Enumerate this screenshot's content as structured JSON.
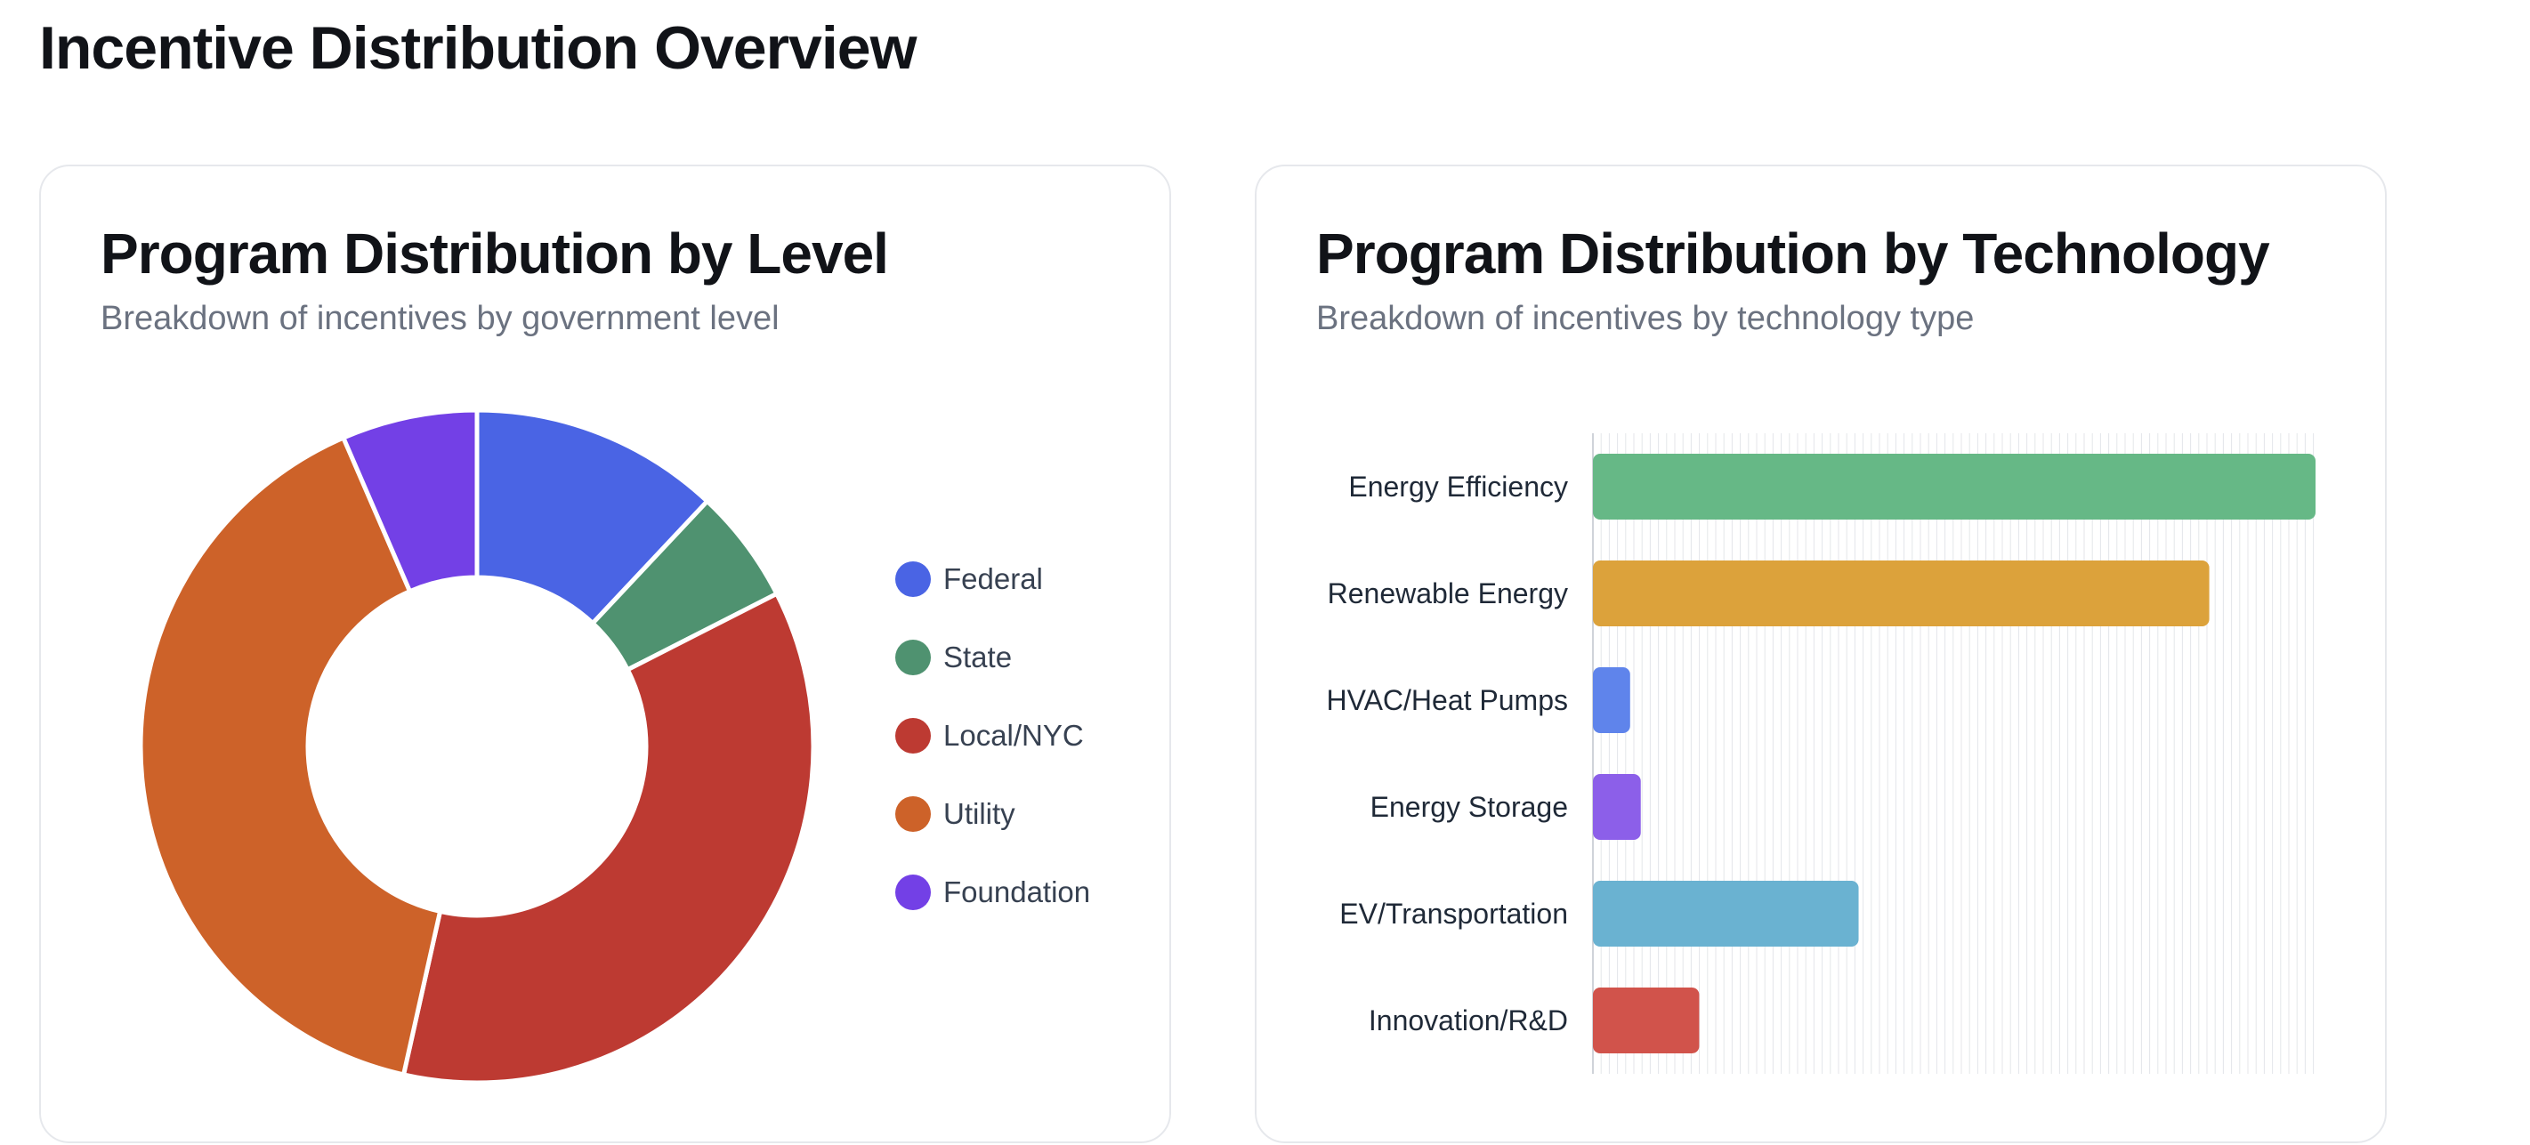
{
  "page": {
    "title": "Incentive Distribution Overview"
  },
  "cards": [
    {
      "title": "Program Distribution by Level",
      "subtitle": "Breakdown of incentives by government level"
    },
    {
      "title": "Program Distribution by Technology",
      "subtitle": "Breakdown of incentives by technology type"
    }
  ],
  "chart_data": [
    {
      "type": "pie",
      "variant": "doughnut",
      "categories": [
        "Federal",
        "State",
        "Local/NYC",
        "Utility",
        "Foundation"
      ],
      "values": [
        12,
        5.5,
        36,
        40,
        6.5
      ],
      "colors": [
        "#4a64e4",
        "#4f9270",
        "#bd3a32",
        "#cd6229",
        "#7340e6"
      ],
      "legend_position": "right"
    },
    {
      "type": "bar",
      "orientation": "horizontal",
      "categories": [
        "Energy Efficiency",
        "Renewable Energy",
        "HVAC/Heat Pumps",
        "Energy Storage",
        "EV/Transportation",
        "Innovation/R&D"
      ],
      "values": [
        68,
        58,
        3.5,
        4.5,
        25,
        10
      ],
      "colors": [
        "#66b886",
        "#dca23b",
        "#5f84eb",
        "#8c5fe9",
        "#6ab2d1",
        "#d1534b"
      ],
      "xlim": [
        0,
        68
      ],
      "grid": true
    }
  ]
}
